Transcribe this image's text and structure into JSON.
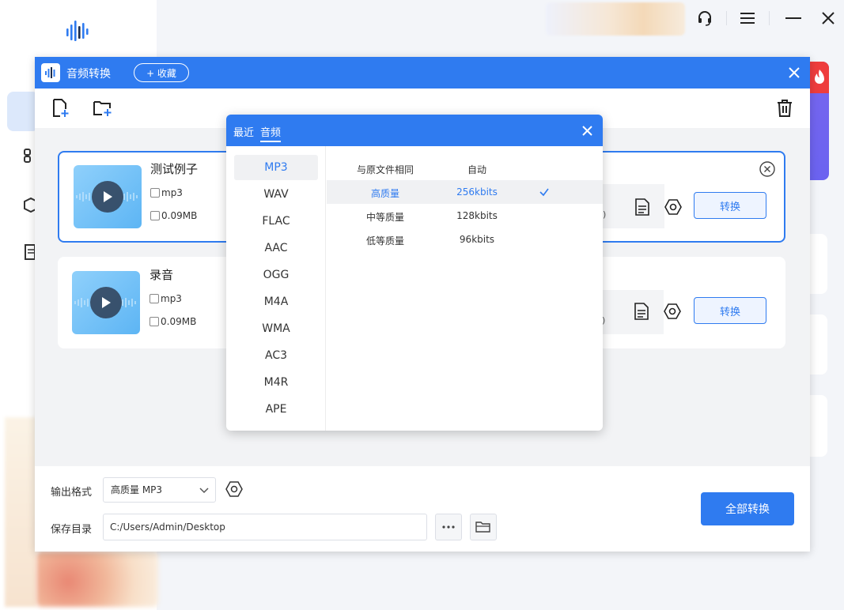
{
  "app": {
    "title": "音频转换",
    "favorite_label": "+ 收藏"
  },
  "files": [
    {
      "name": "测试例子",
      "format": "mp3",
      "size": "0.09MB",
      "convert_label": "转换",
      "edge_text": ")"
    },
    {
      "name": "录音",
      "format": "mp3",
      "size": "0.09MB",
      "convert_label": "转换",
      "edge_text": ")"
    }
  ],
  "output": {
    "format_label": "输出格式",
    "format_value": "高质量 MP3",
    "dir_label": "保存目录",
    "dir_value": "C:/Users/Admin/Desktop",
    "convert_all_label": "全部转换"
  },
  "popup": {
    "tabs": [
      "最近",
      "音频"
    ],
    "active_tab": "音频",
    "formats": [
      "MP3",
      "WAV",
      "FLAC",
      "AAC",
      "OGG",
      "M4A",
      "WMA",
      "AC3",
      "M4R",
      "APE"
    ],
    "selected_format": "MP3",
    "qualities": [
      {
        "name": "与原文件相同",
        "rate": "自动"
      },
      {
        "name": "高质量",
        "rate": "256kbits"
      },
      {
        "name": "中等质量",
        "rate": "128kbits"
      },
      {
        "name": "低等质量",
        "rate": "96kbits"
      }
    ],
    "selected_quality": "高质量"
  },
  "colors": {
    "accent": "#2f7bf0",
    "selected_bg": "#f0f1f3"
  }
}
